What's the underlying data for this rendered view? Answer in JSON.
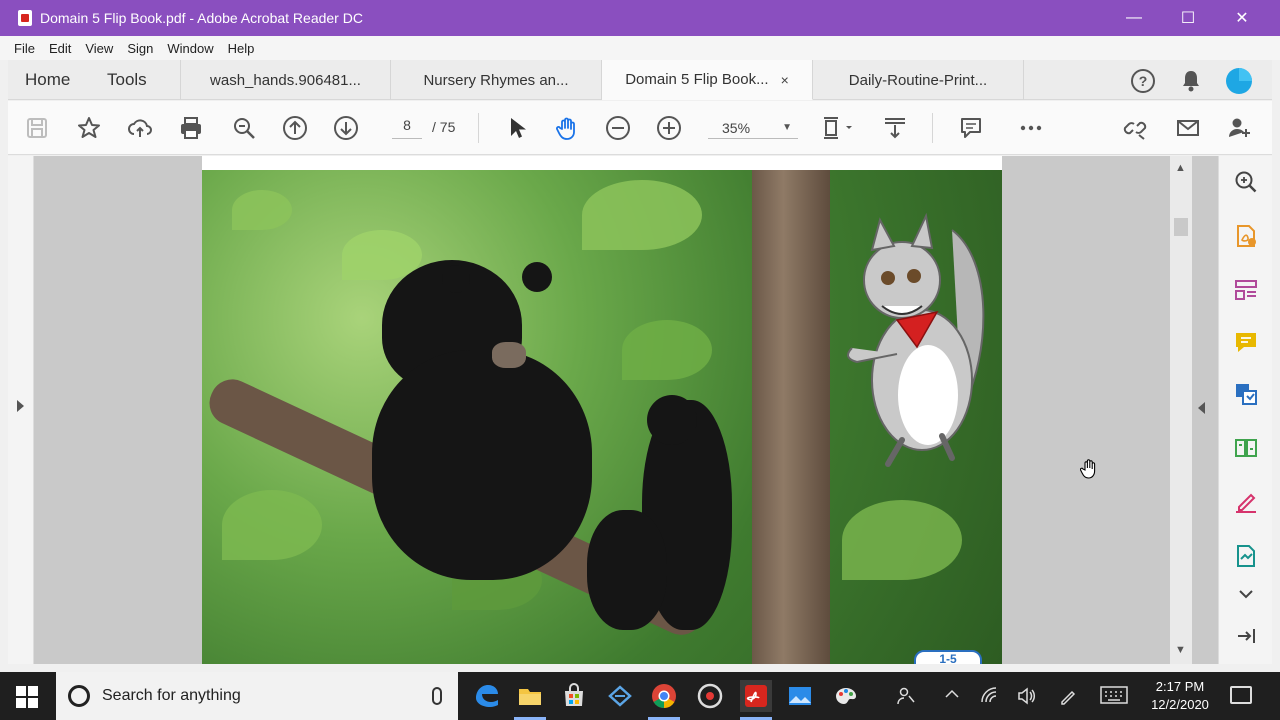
{
  "window": {
    "title": "Domain 5 Flip Book.pdf - Adobe Acrobat Reader DC",
    "minimize": "—",
    "maximize": "☐",
    "close": "✕"
  },
  "menu": {
    "items": [
      "File",
      "Edit",
      "View",
      "Sign",
      "Window",
      "Help"
    ]
  },
  "nav": {
    "home": "Home",
    "tools": "Tools"
  },
  "tabs": [
    {
      "label": "wash_hands.906481..."
    },
    {
      "label": "Nursery Rhymes an..."
    },
    {
      "label": "Domain 5 Flip Book...",
      "close": "×"
    },
    {
      "label": "Daily-Routine-Print..."
    }
  ],
  "toolbar": {
    "page_current": "8",
    "page_sep": "/  75",
    "zoom": "35%"
  },
  "page": {
    "badge": "1-5"
  },
  "taskbar": {
    "search_placeholder": "Search for anything",
    "time": "2:17 PM",
    "date": "12/2/2020"
  },
  "colors": {
    "titlebar": "#8a4fbf",
    "accent_blue": "#2a6fc0",
    "acrobat_red": "#d7261e",
    "tool_orange": "#e8962a",
    "tool_purple": "#b04a9a",
    "tool_yellow": "#e8b800",
    "tool_green": "#3fa34d",
    "tool_pink": "#d6336c",
    "tool_teal": "#16928c"
  }
}
